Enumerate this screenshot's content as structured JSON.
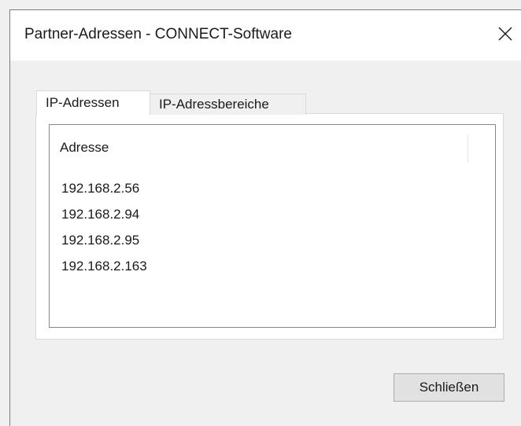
{
  "window": {
    "title": "Partner-Adressen - CONNECT-Software"
  },
  "tabs": [
    {
      "label": "IP-Adressen",
      "active": true
    },
    {
      "label": "IP-Adressbereiche",
      "active": false
    }
  ],
  "list": {
    "column_header": "Adresse",
    "rows": [
      "192.168.2.56",
      "192.168.2.94",
      "192.168.2.95",
      "192.168.2.163"
    ]
  },
  "buttons": {
    "close_label": "Schließen"
  },
  "icons": {
    "close": "close-icon"
  }
}
